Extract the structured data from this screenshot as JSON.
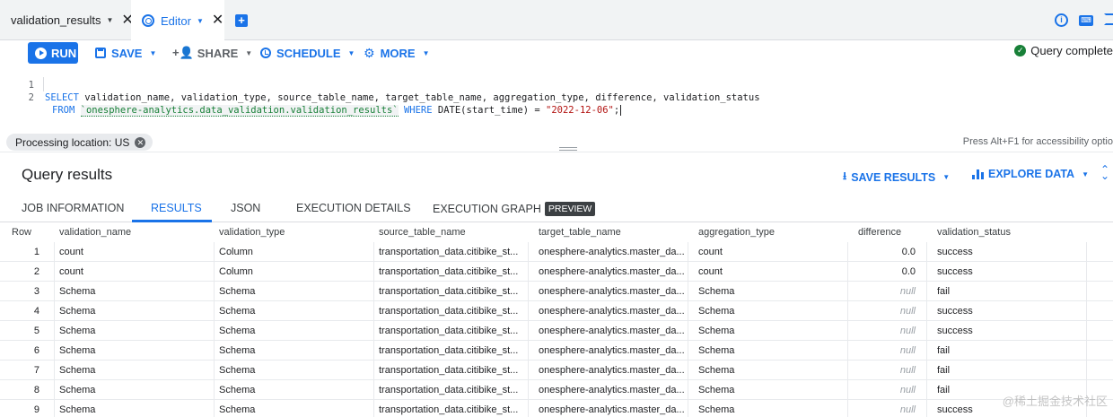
{
  "tabs": [
    {
      "label": "validation_results"
    },
    {
      "label": "Editor"
    }
  ],
  "toolbar": {
    "run_label": "RUN",
    "save_label": "SAVE",
    "share_label": "SHARE",
    "schedule_label": "SCHEDULE",
    "more_label": "MORE",
    "status": "Query complete"
  },
  "editor": {
    "line_numbers": [
      "1",
      "2"
    ],
    "line1": {
      "kw_select": "SELECT",
      "columns": " validation_name, validation_type, source_table_name, target_table_name, aggregation_type, difference, validation_status"
    },
    "line2": {
      "kw_from": "FROM",
      "table": "`onesphere-analytics.data_validation.validation_results`",
      "kw_where": "WHERE",
      "fn": " DATE(start_time) = ",
      "date": "\"2022-12-06\"",
      "end": ";"
    }
  },
  "processing": {
    "chip": "Processing location: US",
    "accessibility": "Press Alt+F1 for accessibility optio"
  },
  "results": {
    "title": "Query results",
    "save_results": "SAVE RESULTS",
    "explore_data": "EXPLORE DATA",
    "tabs": [
      "JOB INFORMATION",
      "RESULTS",
      "JSON",
      "EXECUTION DETAILS",
      "EXECUTION GRAPH"
    ],
    "preview_badge": "PREVIEW",
    "columns": [
      "Row",
      "validation_name",
      "validation_type",
      "source_table_name",
      "target_table_name",
      "aggregation_type",
      "difference",
      "validation_status"
    ],
    "rows": [
      [
        "1",
        "count",
        "Column",
        "transportation_data.citibike_st...",
        "onesphere-analytics.master_da...",
        "count",
        "0.0",
        "success"
      ],
      [
        "2",
        "count",
        "Column",
        "transportation_data.citibike_st...",
        "onesphere-analytics.master_da...",
        "count",
        "0.0",
        "success"
      ],
      [
        "3",
        "Schema",
        "Schema",
        "transportation_data.citibike_st...",
        "onesphere-analytics.master_da...",
        "Schema",
        "null",
        "fail"
      ],
      [
        "4",
        "Schema",
        "Schema",
        "transportation_data.citibike_st...",
        "onesphere-analytics.master_da...",
        "Schema",
        "null",
        "success"
      ],
      [
        "5",
        "Schema",
        "Schema",
        "transportation_data.citibike_st...",
        "onesphere-analytics.master_da...",
        "Schema",
        "null",
        "success"
      ],
      [
        "6",
        "Schema",
        "Schema",
        "transportation_data.citibike_st...",
        "onesphere-analytics.master_da...",
        "Schema",
        "null",
        "fail"
      ],
      [
        "7",
        "Schema",
        "Schema",
        "transportation_data.citibike_st...",
        "onesphere-analytics.master_da...",
        "Schema",
        "null",
        "fail"
      ],
      [
        "8",
        "Schema",
        "Schema",
        "transportation_data.citibike_st...",
        "onesphere-analytics.master_da...",
        "Schema",
        "null",
        "fail"
      ],
      [
        "9",
        "Schema",
        "Schema",
        "transportation_data.citibike_st...",
        "onesphere-analytics.master_da...",
        "Schema",
        "null",
        "success"
      ]
    ]
  },
  "watermark": "@稀土掘金技术社区",
  "colors": {
    "accent": "#1a73e8",
    "success": "#188038",
    "string": "#b31412"
  }
}
